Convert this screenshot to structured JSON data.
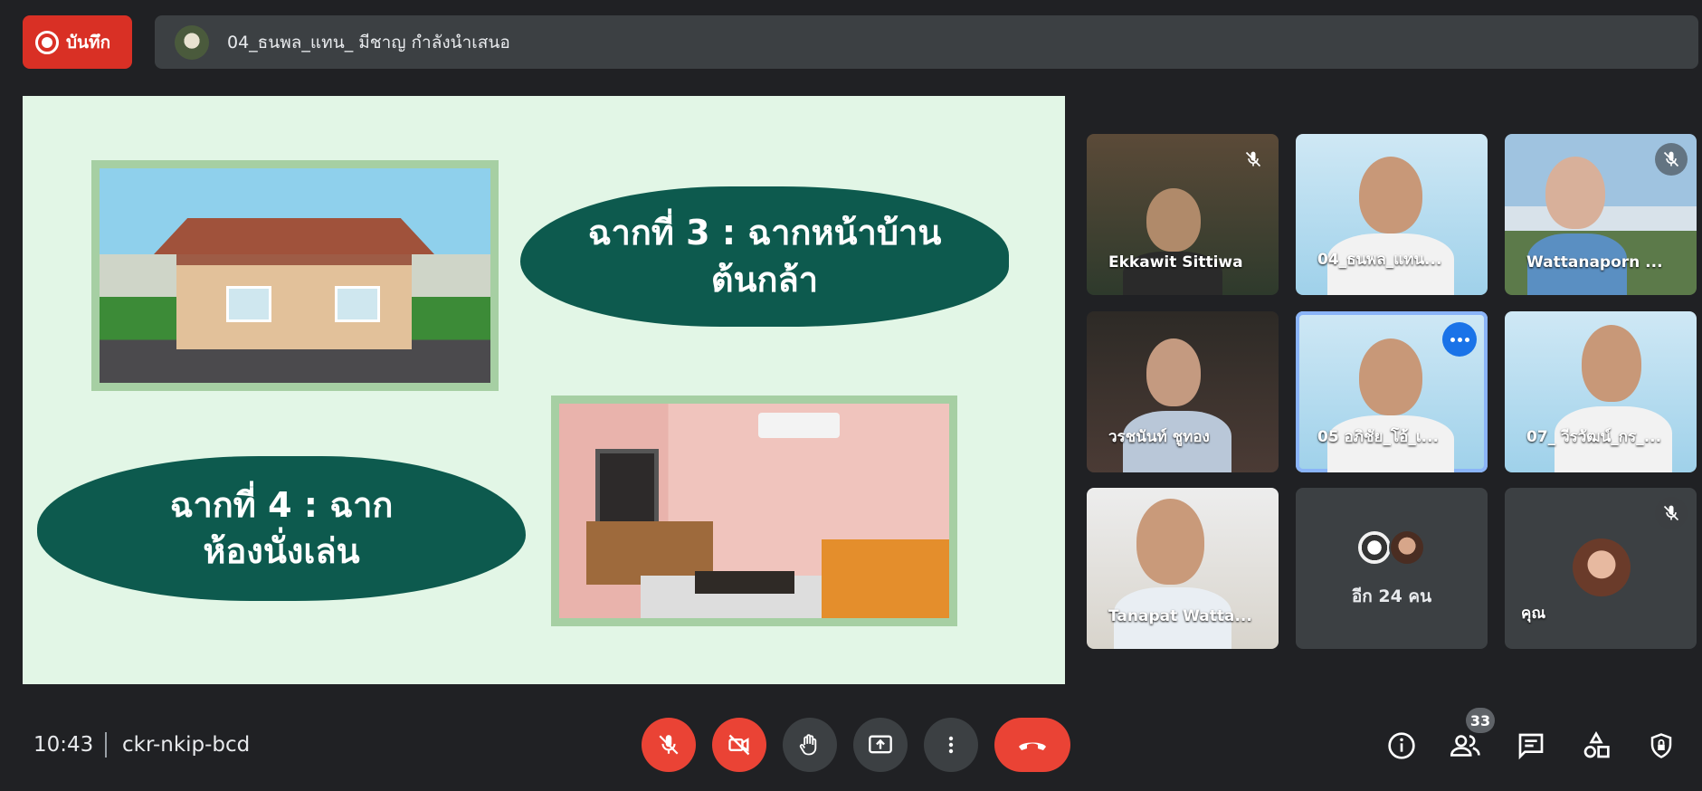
{
  "topbar": {
    "record_label": "บันทึก",
    "presenter_text": "04_ธนพล_แทน_ มีชาญ กำลังนำเสนอ"
  },
  "slide": {
    "scene3_title_line1": "ฉากที่ 3 : ฉากหน้าบ้าน",
    "scene3_title_line2": "ต้นกล้า",
    "scene4_title_line1": "ฉากที่ 4 : ฉาก",
    "scene4_title_line2": "ห้องนั่งเล่น"
  },
  "participants": [
    {
      "name": "Ekkawit Sittiwa",
      "muted": true
    },
    {
      "name": "04_ธนพล_แทน...",
      "muted": false
    },
    {
      "name": "Wattanaporn ...",
      "muted": true
    },
    {
      "name": "วรชนันท์ ชูทอง",
      "muted": false
    },
    {
      "name": "05 อภิชัย_โอ้_เ...",
      "muted": false,
      "active": true
    },
    {
      "name": "07_ วีรวัฒน์_กร_...",
      "muted": false
    },
    {
      "name": "Tanapat Watta...",
      "muted": false
    }
  ],
  "others_tile": {
    "label": "อีก 24 คน"
  },
  "self_tile": {
    "label": "คุณ",
    "muted": true
  },
  "bottombar": {
    "time": "10:43",
    "meeting_code": "ckr-nkip-bcd",
    "participant_count": "33"
  },
  "colors": {
    "background": "#202124",
    "record_red": "#d93025",
    "slide_bg": "#e2f6e6",
    "blob_green": "#0d5a4e",
    "active_blue": "#8ab4f8"
  }
}
